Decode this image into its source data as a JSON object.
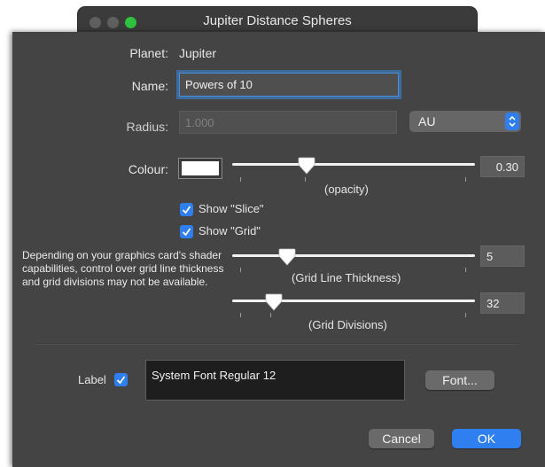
{
  "window": {
    "title": "Jupiter Distance Spheres"
  },
  "planet": {
    "label": "Planet:",
    "value": "Jupiter"
  },
  "name": {
    "label": "Name:",
    "value": "Powers of 10"
  },
  "radius": {
    "label": "Radius:",
    "placeholder": "1.000",
    "unit": "AU"
  },
  "colour": {
    "label": "Colour:",
    "swatch_color": "#ffffff",
    "opacity": 0.3,
    "opacity_text": "0.30",
    "opacity_caption": "(opacity)"
  },
  "show_slice": {
    "label": "Show \"Slice\"",
    "checked": true
  },
  "show_grid": {
    "label": "Show \"Grid\"",
    "checked": true
  },
  "grid_note": "Depending on your graphics card's shader capabilities, control over grid line thickness and grid divisions may not be available.",
  "grid_line_thickness": {
    "value": "5",
    "caption": "(Grid Line Thickness)"
  },
  "grid_divisions": {
    "value": "32",
    "caption": "(Grid Divisions)"
  },
  "label_option": {
    "label": "Label",
    "checked": true
  },
  "font": {
    "value": "System Font Regular 12",
    "button": "Font..."
  },
  "buttons": {
    "cancel": "Cancel",
    "ok": "OK"
  },
  "colors": {
    "accent": "#2f7ff0",
    "panel": "#444444"
  }
}
